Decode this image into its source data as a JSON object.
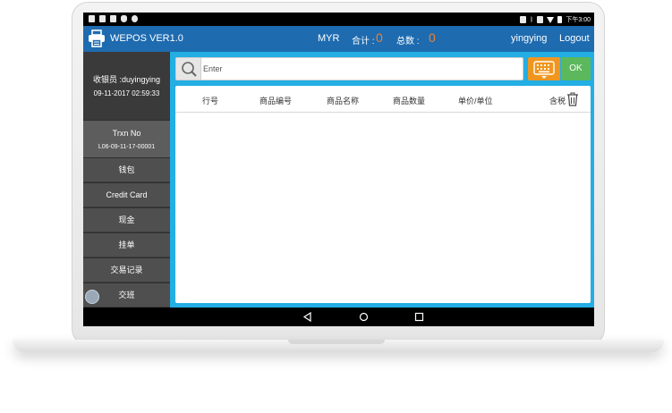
{
  "status_bar": {
    "left_icons": [
      "notification-icon",
      "signal-off-icon",
      "image-icon",
      "shield-icon",
      "app-icon"
    ],
    "right_icons": [
      "nfc-icon",
      "bluetooth-icon",
      "vibrate-icon",
      "wifi-icon",
      "battery-icon"
    ],
    "time": "下午3:00"
  },
  "header": {
    "title": "WEPOS VER1.0",
    "currency": "MYR",
    "total_label": "合计 :",
    "total_value": "0",
    "count_label": "总数 :",
    "count_value": "0",
    "username": "yingying",
    "logout_label": "Logout"
  },
  "sidebar": {
    "cashier": "收银员 :duyingying",
    "datetime": "09-11-2017 02:59:33",
    "trxn_label": "Trxn No",
    "trxn_no": "L06-09-11-17-00001",
    "menu": [
      "钱包",
      "Credit Card",
      "现金",
      "挂单",
      "交易记录",
      "交班"
    ]
  },
  "search": {
    "placeholder": "Enter",
    "ok_label": "OK"
  },
  "table": {
    "columns": [
      "行号",
      "商品编号",
      "商品名称",
      "商品数量",
      "单价/单位",
      "含税"
    ],
    "rows": []
  },
  "colors": {
    "header_blue": "#1e6bb0",
    "main_cyan": "#23aee4",
    "sidebar_dark": "#3d3d3d",
    "keyboard_orange": "#f0961e",
    "ok_green": "#5cb85c",
    "total_orange": "#f08030"
  }
}
